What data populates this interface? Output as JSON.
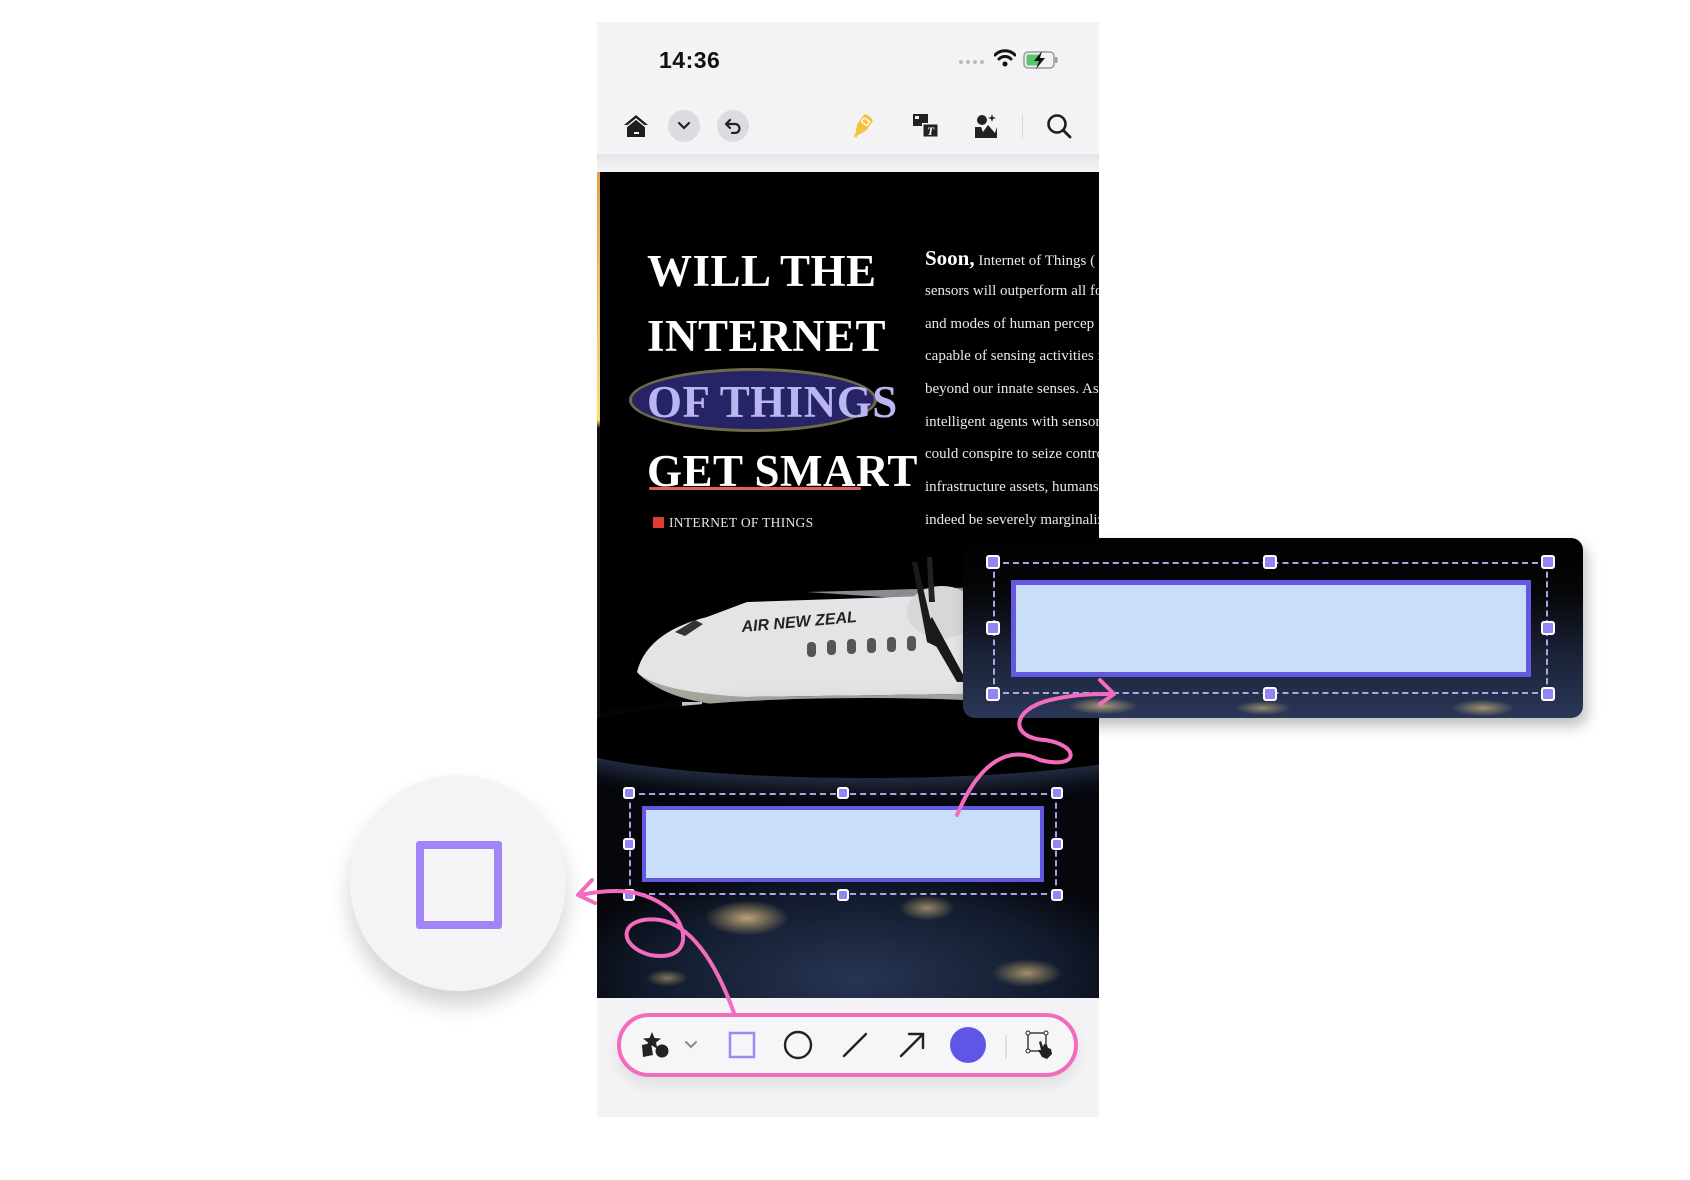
{
  "status_bar": {
    "time": "14:36",
    "wifi_icon": "wifi-icon",
    "battery_icon": "battery-charging-icon"
  },
  "top_toolbar": {
    "items": [
      {
        "name": "home",
        "icon": "home-icon"
      },
      {
        "name": "more-dropdown",
        "icon": "chevron-down-icon"
      },
      {
        "name": "undo",
        "icon": "undo-icon"
      },
      {
        "name": "highlighter",
        "icon": "highlighter-icon",
        "color": "#f3c43d"
      },
      {
        "name": "translate",
        "icon": "image-text-icon"
      },
      {
        "name": "ai-image",
        "icon": "person-sparkle-icon"
      },
      {
        "name": "search",
        "icon": "search-icon"
      }
    ]
  },
  "document": {
    "headline": [
      "WILL THE",
      "INTERNET",
      "OF THINGS",
      "GET SMART"
    ],
    "tag": "INTERNET OF THINGS",
    "paragraph_lead": "Soon,",
    "paragraph_lines": [
      "Internet of Things (",
      "sensors will outperform all fo",
      "and modes of  human percep",
      "capable of sensing activities f",
      "beyond our innate senses. As",
      "intelligent agents with sensor",
      "could conspire to seize contro",
      "infrastructure assets, humans",
      "indeed be severely marginaliz"
    ],
    "airplane_livery": "AIR NEW ZEAL"
  },
  "bottom_toolbar": {
    "items": [
      {
        "name": "shapes-menu",
        "icon": "shapes-icon"
      },
      {
        "name": "shapes-dropdown",
        "icon": "chevron-down-icon"
      },
      {
        "name": "rectangle-tool",
        "icon": "square-icon",
        "selected": true,
        "color": "#9d8bf5"
      },
      {
        "name": "ellipse-tool",
        "icon": "circle-icon"
      },
      {
        "name": "line-tool",
        "icon": "line-icon"
      },
      {
        "name": "arrow-tool",
        "icon": "arrow-icon"
      },
      {
        "name": "color-picker",
        "icon": "color-dot-icon",
        "color": "#5f55e6"
      },
      {
        "name": "select-tool",
        "icon": "select-hand-icon"
      }
    ]
  },
  "colors": {
    "accent": "#6458e0",
    "shape_fill": "#c9def9",
    "handle": "#9485f5",
    "annotation_pink": "#f26bbd",
    "magnifier_square": "#a184f5"
  },
  "magnifier": {
    "icon": "square-icon"
  }
}
